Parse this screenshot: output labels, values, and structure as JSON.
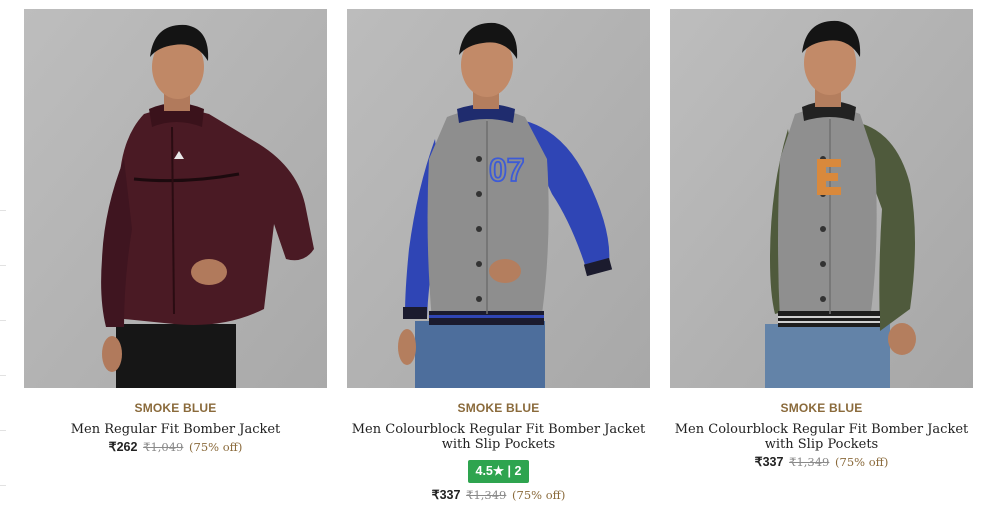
{
  "products": [
    {
      "brand": "SMOKE BLUE",
      "title": "Men Regular Fit Bomber Jacket",
      "price": "₹262",
      "mrp": "₹1,049",
      "discount": "(75% off)",
      "image": "maroon-zip-jacket"
    },
    {
      "brand": "SMOKE BLUE",
      "title": "Men Colourblock Regular Fit Bomber Jacket with Slip Pockets",
      "price": "₹337",
      "mrp": "₹1,349",
      "discount": "(75% off)",
      "rating": "4.5★ | 2",
      "image": "grey-blue-varsity-jacket-07"
    },
    {
      "brand": "SMOKE BLUE",
      "title": "Men Colourblock Regular Fit Bomber Jacket with Slip Pockets",
      "price": "₹337",
      "mrp": "₹1,349",
      "discount": "(75% off)",
      "image": "grey-olive-varsity-jacket-E"
    }
  ],
  "colors": {
    "brand": "#8a6a3b",
    "rating_bg": "#2ea44f",
    "image_bg": "#b4b4b4"
  }
}
